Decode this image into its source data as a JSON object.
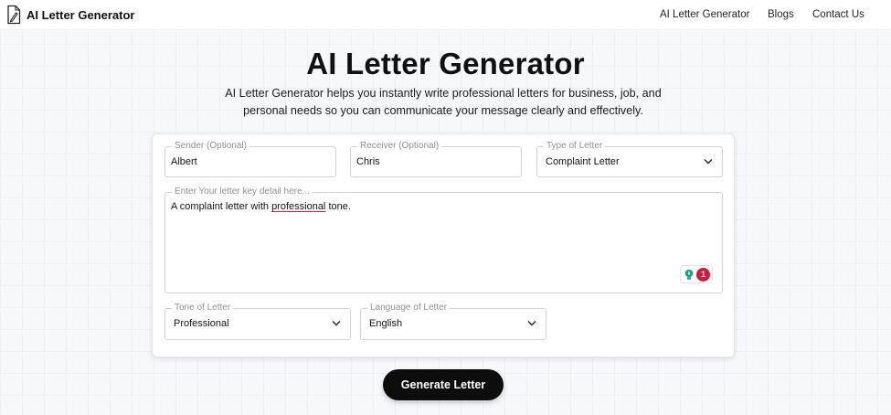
{
  "header": {
    "brand": "AI Letter Generator",
    "logo_icon": "document-pen-icon",
    "nav": [
      "AI Letter Generator",
      "Blogs",
      "Contact Us"
    ]
  },
  "hero": {
    "title": "AI Letter Generator",
    "description": "AI Letter Generator helps you instantly write professional letters for business, job, and personal needs so you can communicate your message clearly and effectively."
  },
  "form": {
    "sender": {
      "label": "Sender (Optional)",
      "value": "Albert"
    },
    "receiver": {
      "label": "Receiver (Optional)",
      "value": "Chris"
    },
    "type": {
      "label": "Type of Letter",
      "value": "Complaint Letter"
    },
    "detail": {
      "label": "Enter Your letter key detail here...",
      "value_before": "A complaint letter with ",
      "value_flagged": "professional",
      "value_after": " tone."
    },
    "grammar_badge_count": "1",
    "tone": {
      "label": "Tone of Letter",
      "value": "Professional"
    },
    "language": {
      "label": "Language of Letter",
      "value": "English"
    }
  },
  "actions": {
    "generate_label": "Generate Letter"
  },
  "colors": {
    "accent": "#0d0d0d",
    "badge": "#d11a3a",
    "assistant_icon": "#16a085",
    "spell_underline": "#d0213a"
  }
}
